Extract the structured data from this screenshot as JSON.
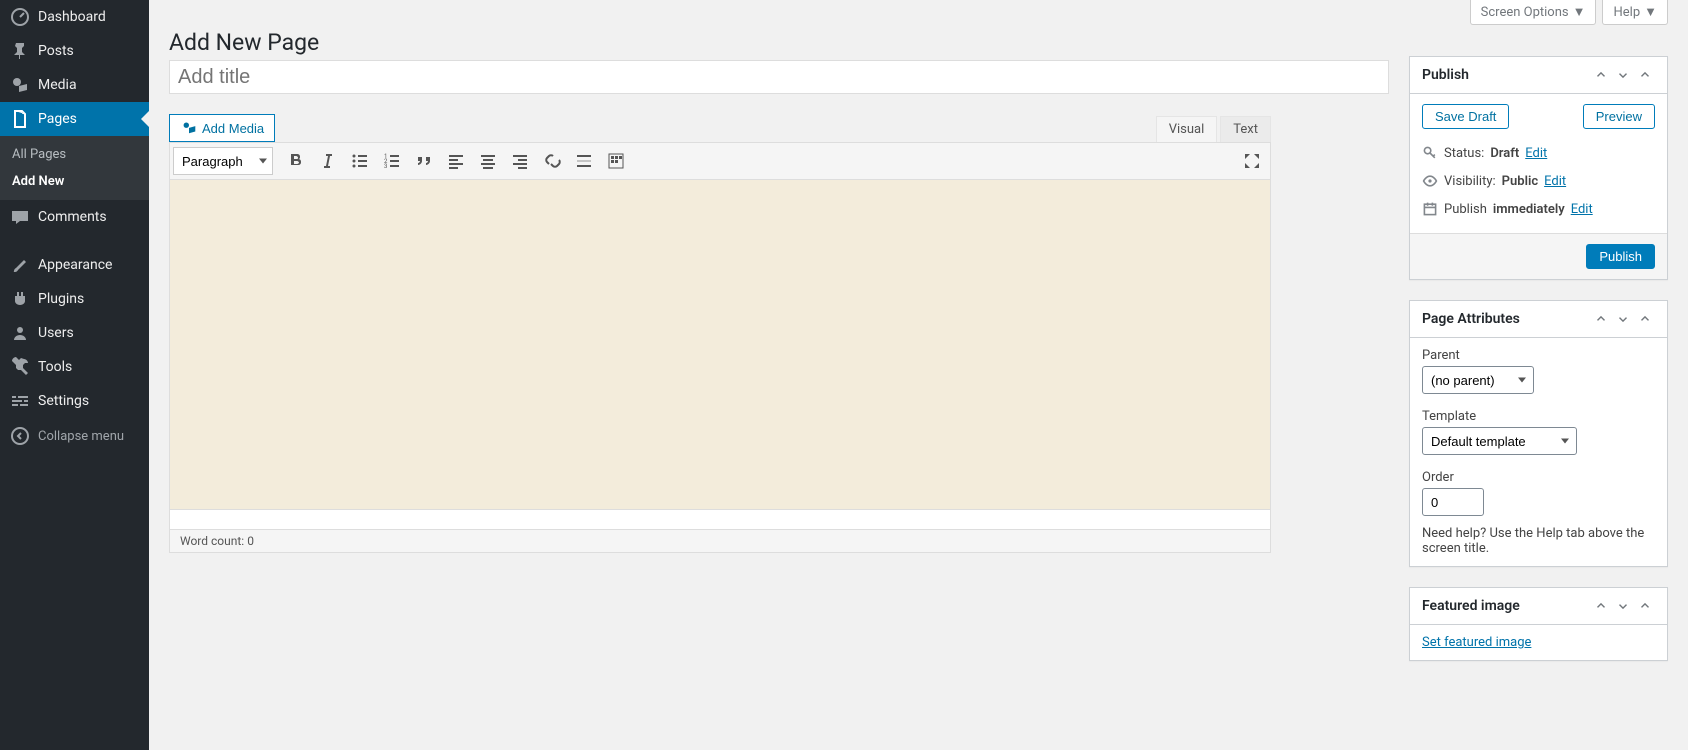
{
  "sidebar": {
    "items": [
      {
        "label": "Dashboard",
        "icon": "dashboard"
      },
      {
        "label": "Posts",
        "icon": "posts"
      },
      {
        "label": "Media",
        "icon": "media"
      },
      {
        "label": "Pages",
        "icon": "pages",
        "active": true
      },
      {
        "label": "Comments",
        "icon": "comments"
      },
      {
        "label": "Appearance",
        "icon": "appearance"
      },
      {
        "label": "Plugins",
        "icon": "plugins"
      },
      {
        "label": "Users",
        "icon": "users"
      },
      {
        "label": "Tools",
        "icon": "tools"
      },
      {
        "label": "Settings",
        "icon": "settings"
      }
    ],
    "submenu": [
      {
        "label": "All Pages"
      },
      {
        "label": "Add New",
        "current": true
      }
    ],
    "collapse_label": "Collapse menu"
  },
  "top_tabs": {
    "screen_options": "Screen Options",
    "help": "Help"
  },
  "page_title": "Add New Page",
  "title_placeholder": "Add title",
  "editor": {
    "add_media": "Add Media",
    "tabs": {
      "visual": "Visual",
      "text": "Text"
    },
    "format_select": "Paragraph",
    "word_count_label": "Word count:",
    "word_count": "0"
  },
  "publish_box": {
    "title": "Publish",
    "save_draft": "Save Draft",
    "preview": "Preview",
    "status_label": "Status:",
    "status_value": "Draft",
    "visibility_label": "Visibility:",
    "visibility_value": "Public",
    "publish_label": "Publish",
    "publish_time": "immediately",
    "edit": "Edit",
    "publish_button": "Publish"
  },
  "attributes_box": {
    "title": "Page Attributes",
    "parent_label": "Parent",
    "parent_value": "(no parent)",
    "template_label": "Template",
    "template_value": "Default template",
    "order_label": "Order",
    "order_value": "0",
    "help_text": "Need help? Use the Help tab above the screen title."
  },
  "featured_box": {
    "title": "Featured image",
    "set_link": "Set featured image"
  }
}
